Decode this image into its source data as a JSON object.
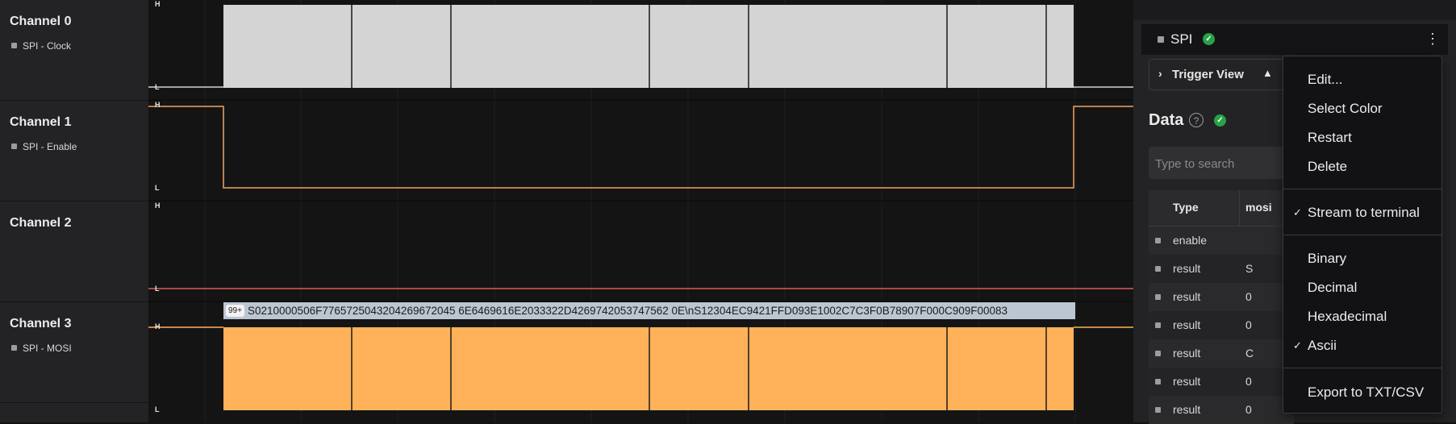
{
  "channels": [
    {
      "name": "Channel 0",
      "sub": "SPI - Clock"
    },
    {
      "name": "Channel 1",
      "sub": "SPI - Enable"
    },
    {
      "name": "Channel 2",
      "sub": ""
    },
    {
      "name": "Channel 3",
      "sub": "SPI - MOSI"
    }
  ],
  "wave": {
    "high_label": "H",
    "low_label": "L",
    "decode_badge": "99+",
    "decode_text": "S0210000506F7765725043204269672045 6E6469616E2033322D4269742053747562 0E\\nS12304EC9421FFD093E1002C7C3F0B78907F000C909F00083"
  },
  "panel": {
    "analyzer_name": "SPI",
    "ok_mark": "✓",
    "kebab": "⋮",
    "trigger_label": "Trigger View",
    "trigger_chevron": "›",
    "trigger_warn": "▲",
    "data_title": "Data",
    "help": "?",
    "search_placeholder": "Type to search",
    "table_headers": {
      "type": "Type",
      "mosi": "mosi"
    },
    "rows": [
      {
        "type": "enable",
        "mosi": ""
      },
      {
        "type": "result",
        "mosi": "S"
      },
      {
        "type": "result",
        "mosi": "0"
      },
      {
        "type": "result",
        "mosi": "0"
      },
      {
        "type": "result",
        "mosi": "C"
      },
      {
        "type": "result",
        "mosi": "0"
      },
      {
        "type": "result",
        "mosi": "0"
      }
    ]
  },
  "menu": {
    "edit": "Edit...",
    "select_color": "Select Color",
    "restart": "Restart",
    "delete": "Delete",
    "stream": "Stream to terminal",
    "binary": "Binary",
    "decimal": "Decimal",
    "hexadecimal": "Hexadecimal",
    "ascii": "Ascii",
    "export": "Export to TXT/CSV",
    "check": "✓"
  },
  "colors": {
    "clock_fill": "#d4d4d4",
    "enable_line": "#f2a35e",
    "ch2_line": "#e05a5a",
    "mosi_fill": "#ffb25a",
    "ok_green": "#27a347"
  }
}
